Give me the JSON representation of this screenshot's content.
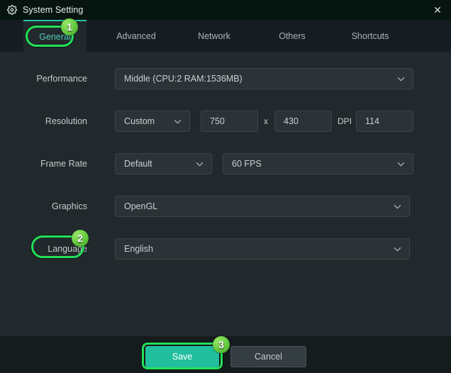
{
  "window": {
    "title": "System Setting",
    "gear_icon": "gear-icon",
    "close_label": "✕"
  },
  "tabs": [
    {
      "label": "General",
      "active": true
    },
    {
      "label": "Advanced",
      "active": false
    },
    {
      "label": "Network",
      "active": false
    },
    {
      "label": "Others",
      "active": false
    },
    {
      "label": "Shortcuts",
      "active": false
    }
  ],
  "settings": {
    "performance": {
      "label": "Performance",
      "value": "Middle (CPU:2 RAM:1536MB)"
    },
    "resolution": {
      "label": "Resolution",
      "mode": "Custom",
      "width": "750",
      "separator": "x",
      "height": "430",
      "dpi_label": "DPI",
      "dpi": "114"
    },
    "frame_rate": {
      "label": "Frame Rate",
      "mode": "Default",
      "fps": "60 FPS"
    },
    "graphics": {
      "label": "Graphics",
      "value": "OpenGL"
    },
    "language": {
      "label": "Language",
      "value": "English"
    }
  },
  "footer": {
    "save_label": "Save",
    "cancel_label": "Cancel"
  },
  "annotations": {
    "badge1": "1",
    "badge2": "2",
    "badge3": "3"
  },
  "colors": {
    "accent_teal": "#21bf9e",
    "highlight_green": "#22e05a",
    "tab_active_text": "#4fc9b6",
    "titlebar_bg": "#071510",
    "content_bg": "#22292c",
    "tabbar_bg": "#161d20",
    "footer_bg": "#161b1e",
    "field_bg": "#2b3337"
  }
}
